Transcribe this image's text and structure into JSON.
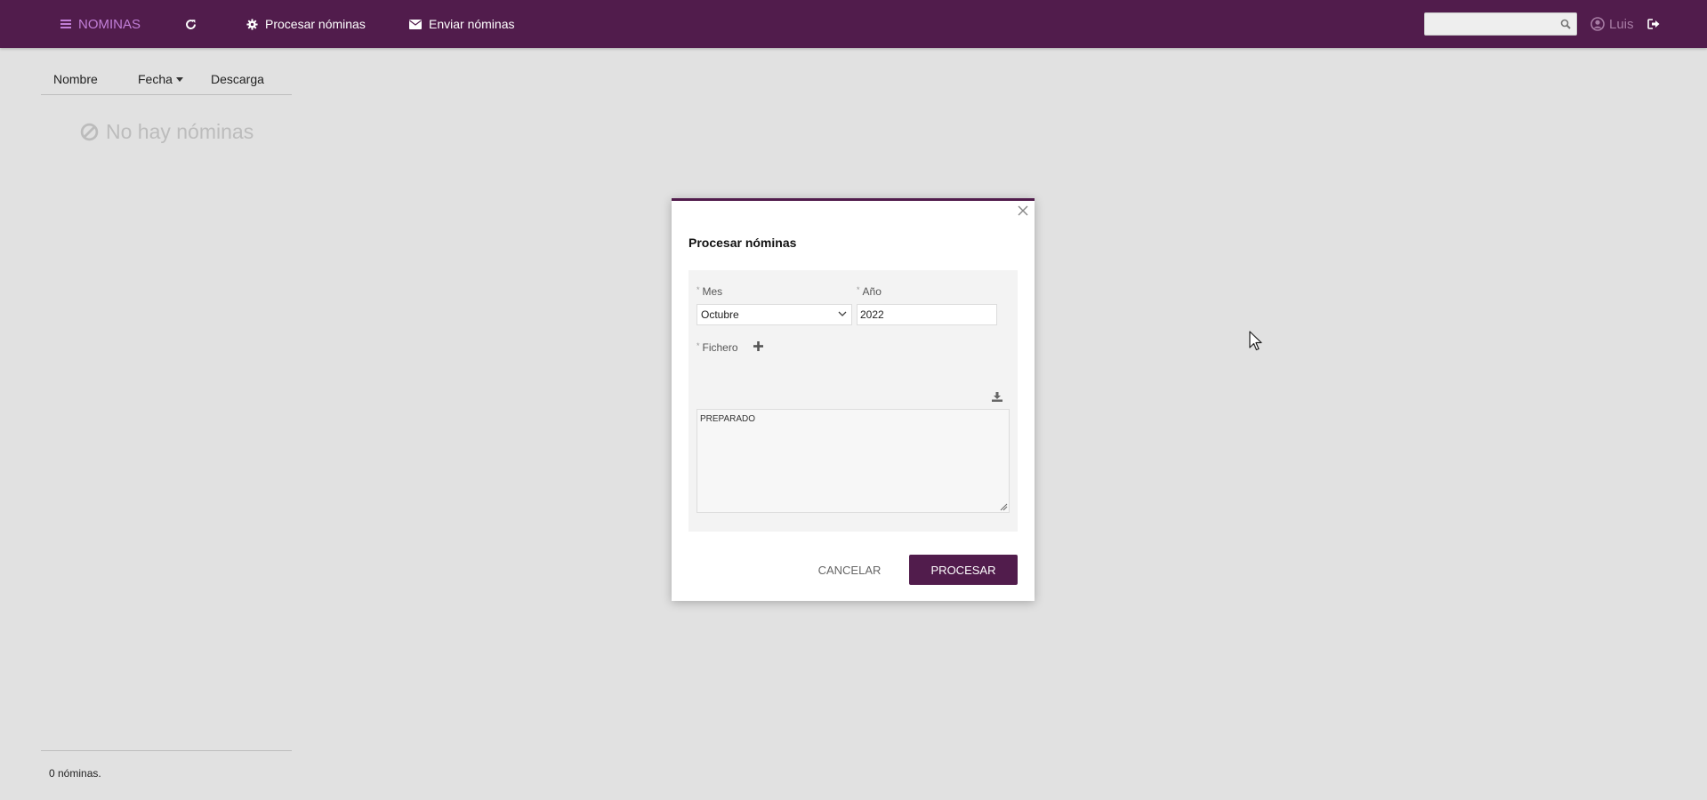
{
  "topbar": {
    "brand": "NOMINAS",
    "procesar_label": "Procesar nóminas",
    "enviar_label": "Enviar nóminas",
    "search_value": "",
    "user_name": "Luis"
  },
  "list": {
    "columns": [
      "Nombre",
      "Fecha",
      "Descarga"
    ],
    "empty_message": "No hay nóminas",
    "footer": "0 nóminas."
  },
  "modal": {
    "title": "Procesar nóminas",
    "mes_label": "Mes",
    "mes_value": "Octubre",
    "ano_label": "Año",
    "ano_value": "2022",
    "fichero_label": "Fichero",
    "log_text": "PREPARADO",
    "cancel_label": "CANCELAR",
    "submit_label": "PROCESAR",
    "required_mark": "*"
  },
  "colors": {
    "primary": "#511c4c",
    "brand_text": "#c27fd8",
    "background": "#e1e1e1"
  }
}
